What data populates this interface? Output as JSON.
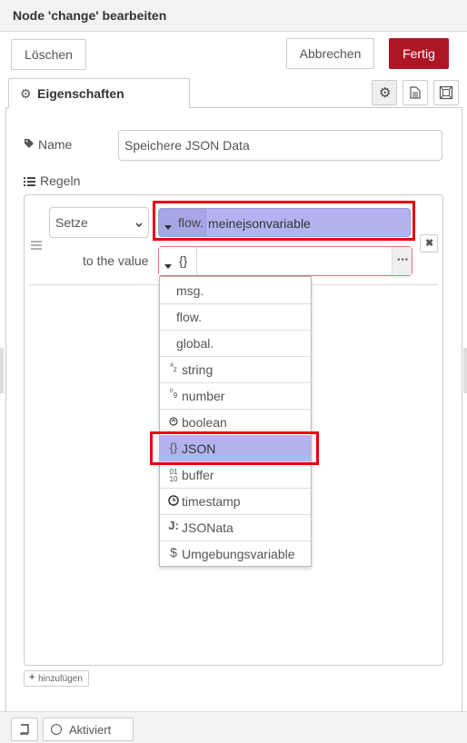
{
  "window": {
    "title": "Node 'change' bearbeiten"
  },
  "toolbar": {
    "delete_label": "Löschen",
    "cancel_label": "Abbrechen",
    "done_label": "Fertig"
  },
  "tabs": {
    "active_label": "Eigenschaften",
    "icons": [
      "gear-icon",
      "document-icon",
      "frame-icon"
    ]
  },
  "form": {
    "name_label": "Name",
    "name_value": "Speichere JSON Data",
    "rules_label": "Regeln"
  },
  "rule": {
    "action_value": "Setze",
    "target_type": "flow.",
    "target_value": "meinejsonvariable",
    "to_label": "to the value",
    "value_type": "{}",
    "value": ""
  },
  "type_menu": {
    "items": [
      {
        "label": "msg.",
        "icon": ""
      },
      {
        "label": "flow.",
        "icon": ""
      },
      {
        "label": "global.",
        "icon": ""
      },
      {
        "label": "string",
        "icon": "string-icon"
      },
      {
        "label": "number",
        "icon": "number-icon"
      },
      {
        "label": "boolean",
        "icon": "boolean-icon"
      },
      {
        "label": "JSON",
        "icon": "json-icon"
      },
      {
        "label": "buffer",
        "icon": "buffer-icon"
      },
      {
        "label": "timestamp",
        "icon": "clock-icon"
      },
      {
        "label": "JSONata",
        "icon": "jsonata-icon"
      },
      {
        "label": "Umgebungsvariable",
        "icon": "dollar-icon"
      }
    ],
    "selected": "JSON"
  },
  "add_button": {
    "label": "hinzufügen"
  },
  "footer": {
    "status_label": "Aktiviert"
  },
  "colors": {
    "primary": "#ad1625",
    "highlight": "#b3b3f0",
    "outline": "#e8000b"
  }
}
